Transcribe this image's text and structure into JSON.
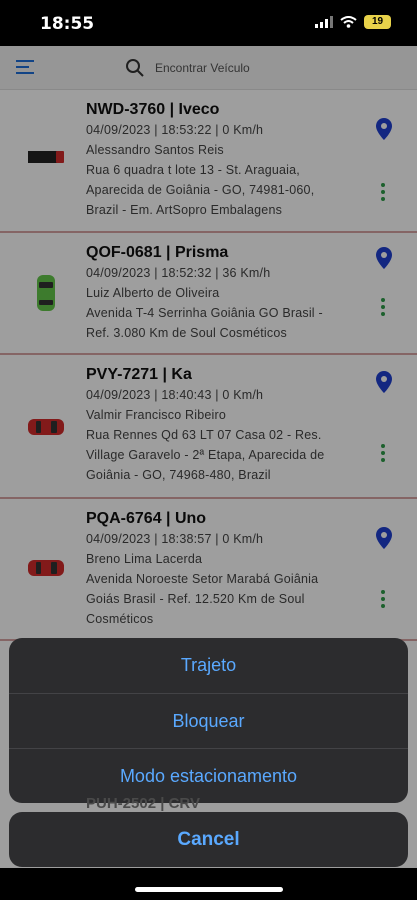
{
  "status_bar": {
    "time": "18:55",
    "battery": "19"
  },
  "search": {
    "placeholder": "Encontrar Veículo"
  },
  "vehicles": [
    {
      "title": "NWD-3760 | Iveco",
      "datetime_speed": "04/09/2023 | 18:53:22 | 0 Km/h",
      "driver": "Alessandro Santos Reis",
      "address_lines": [
        "Rua 6 quadra t lote 13 - St. Araguaia,",
        "Aparecida de Goiânia - GO, 74981-060,",
        "Brazil - Em. ArtSopro Embalagens"
      ],
      "icon": "truck-icon"
    },
    {
      "title": "QOF-0681 | Prisma",
      "datetime_speed": "04/09/2023 | 18:52:32 | 36 Km/h",
      "driver": "Luiz Alberto de Oliveira",
      "address_lines": [
        "Avenida T-4 Serrinha Goiânia GO Brasil -",
        "Ref. 3.080 Km de Soul Cosméticos"
      ],
      "icon": "car-icon"
    },
    {
      "title": "PVY-7271 | Ka",
      "datetime_speed": "04/09/2023 | 18:40:43 | 0 Km/h",
      "driver": "Valmir Francisco Ribeiro",
      "address_lines": [
        "Rua Rennes Qd 63 LT 07 Casa 02 - Res.",
        "Village Garavelo - 2ª Etapa, Aparecida de",
        "Goiânia - GO, 74968-480, Brazil"
      ],
      "icon": "car-icon"
    },
    {
      "title": "PQA-6764 | Uno",
      "datetime_speed": "04/09/2023 | 18:38:57 | 0 Km/h",
      "driver": "Breno Lima Lacerda",
      "address_lines": [
        "Avenida Noroeste Setor Marabá Goiânia",
        "Goiás Brasil - Ref. 12.520 Km de Soul",
        "Cosméticos"
      ],
      "icon": "car-icon"
    }
  ],
  "peek_title": "PUH-2502 | CRV",
  "action_sheet": {
    "actions": [
      "Trajeto",
      "Bloquear",
      "Modo estacionamento"
    ],
    "cancel": "Cancel"
  },
  "colors": {
    "action_text": "#5aa9ff",
    "sheet_bg": "#2c2c2e",
    "pin": "#1f3fd0",
    "more_dots": "#2e9c4a",
    "card_divider": "#d7a4a4",
    "car_red": "#d22a2a",
    "car_green": "#63c74a"
  }
}
